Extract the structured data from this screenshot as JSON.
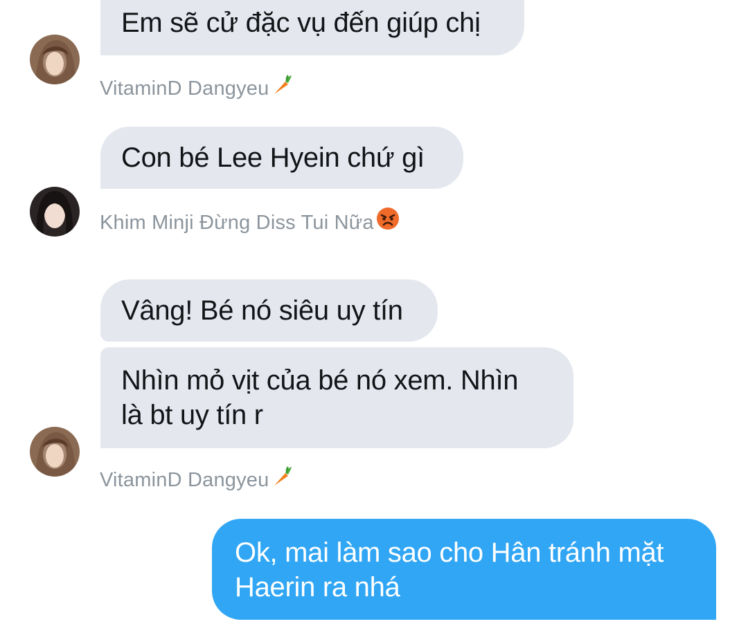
{
  "conversation": {
    "messages": [
      {
        "text": "Em sẽ cử đặc vụ đến giúp chị"
      },
      {
        "text": "Con bé Lee Hyein chứ gì"
      },
      {
        "text": "Vâng! Bé nó siêu uy tín"
      },
      {
        "text": "Nhìn mỏ vịt của bé nó xem. Nhìn\nlà bt uy tín r"
      },
      {
        "text": "Ok, mai làm sao cho Hân tránh mặt\nHaerin ra nhá"
      }
    ],
    "senders": [
      {
        "name": "VitaminD Dangyeu",
        "emoji_icon": "carrot-emoji"
      },
      {
        "name": "Khim Minji Đừng Diss Tui Nữa",
        "emoji_icon": "angry-face-emoji"
      },
      {
        "name": "VitaminD Dangyeu",
        "emoji_icon": "carrot-emoji"
      }
    ]
  },
  "colors": {
    "incoming_bubble": "#e4e8ee",
    "outgoing_bubble": "#31a6f4",
    "sender_text": "#8b949c"
  }
}
